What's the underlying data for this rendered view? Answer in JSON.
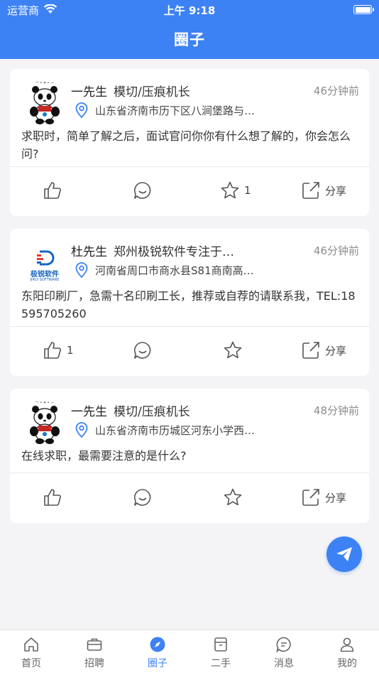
{
  "status_bar": {
    "carrier": "运营商",
    "time": "上午 9:18"
  },
  "header": {
    "title": "圈子"
  },
  "posts": [
    {
      "name": "一先生",
      "role": "模切/压痕机长",
      "time_ago": "46分钟前",
      "location": "山东省济南市历下区八涧堡路与…",
      "content": "求职时，简单了解之后，面试官问你你有什么想了解的，你会怎么问?",
      "like_count": "",
      "star_count": "1",
      "share_label": "分享",
      "avatar": "panda-avatar"
    },
    {
      "name": "杜先生",
      "role": "郑州极锐软件专注于…",
      "time_ago": "46分钟前",
      "location": "河南省周口市商水县S81商南高…",
      "content": "东阳印刷厂，急需十名印刷工长，推荐或自荐的请联系我，TEL:18595705260",
      "like_count": "1",
      "star_count": "",
      "share_label": "分享",
      "avatar": "jirui-logo",
      "logo_text": "极锐软件",
      "logo_subtext": "JIRUI SOFTWARE"
    },
    {
      "name": "一先生",
      "role": "模切/压痕机长",
      "time_ago": "48分钟前",
      "location": "山东省济南市历城区河东小学西…",
      "content": "在线求职，最需要注意的是什么?",
      "like_count": "",
      "star_count": "",
      "share_label": "分享",
      "avatar": "panda-avatar"
    }
  ],
  "tabbar": {
    "items": [
      {
        "label": "首页",
        "icon": "home-icon"
      },
      {
        "label": "招聘",
        "icon": "briefcase-icon"
      },
      {
        "label": "圈子",
        "icon": "compass-icon",
        "active": true
      },
      {
        "label": "二手",
        "icon": "box-icon"
      },
      {
        "label": "消息",
        "icon": "message-icon"
      },
      {
        "label": "我的",
        "icon": "person-icon"
      }
    ]
  },
  "colors": {
    "accent": "#3d82f4",
    "background": "#f4f4f6",
    "muted_text": "#8c8c8c"
  }
}
